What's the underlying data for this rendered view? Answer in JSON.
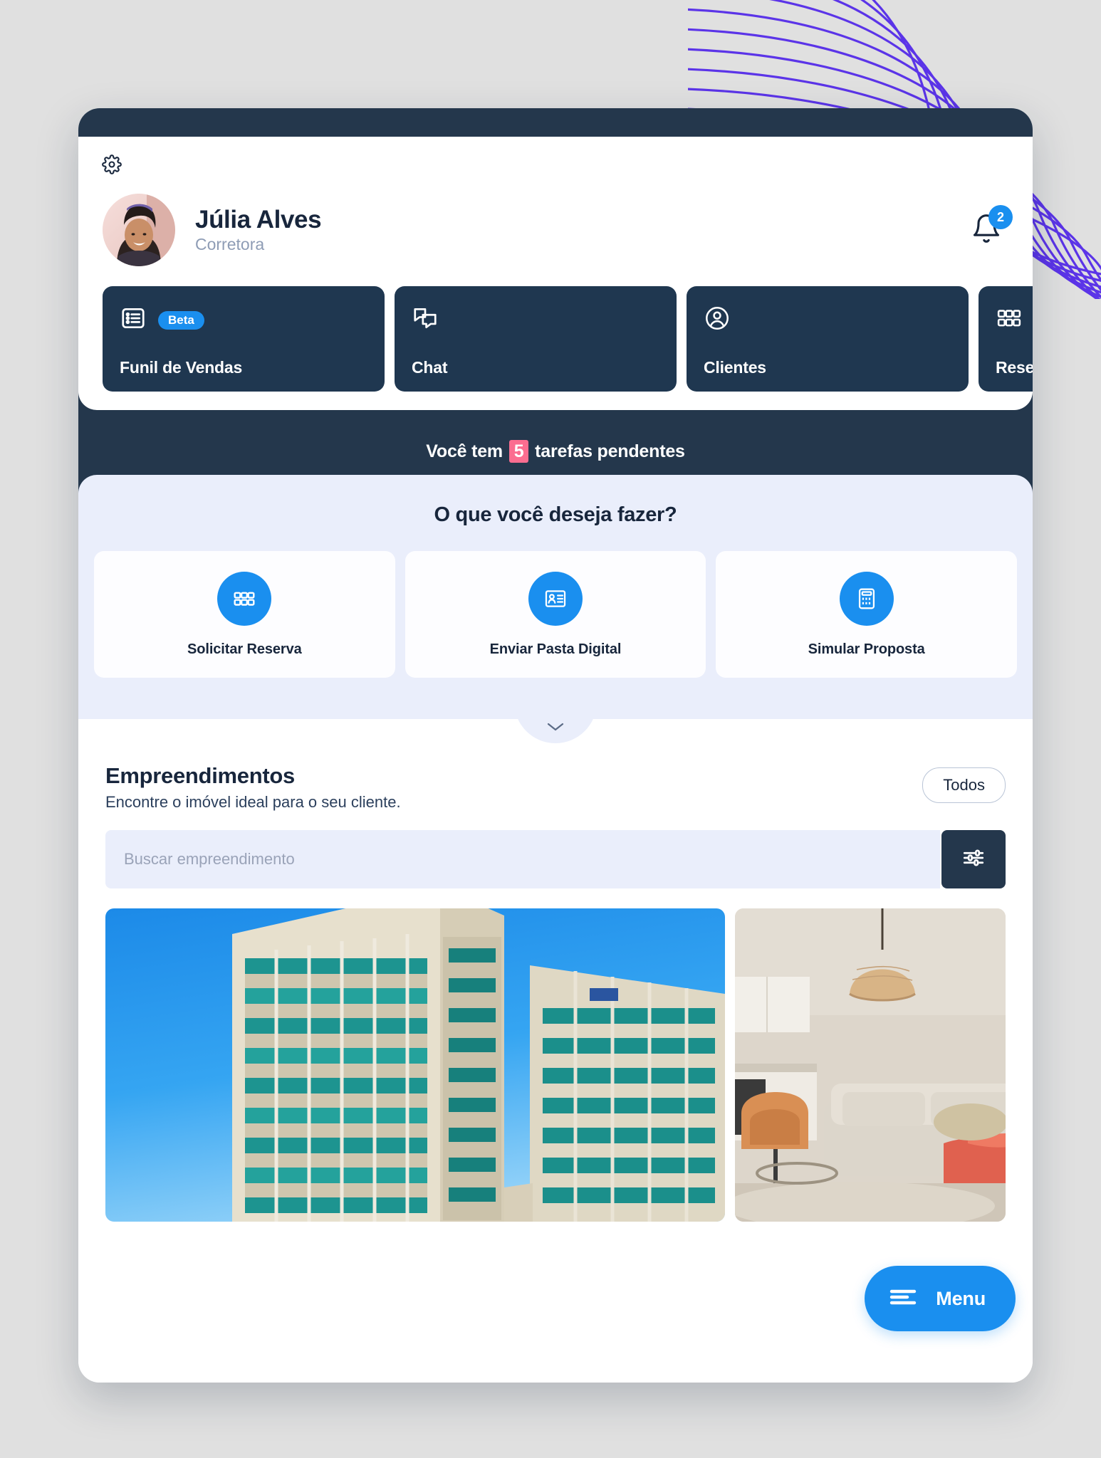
{
  "window": {
    "topbar_color": "#24374c",
    "accent_blue": "#1a8fef",
    "pink": "#fb6d90",
    "panel_bg": "#eaeefb"
  },
  "header": {
    "settings_icon": "gear-icon",
    "profile": {
      "name": "Júlia Alves",
      "role": "Corretora",
      "avatar_alt": "Júlia Alves"
    },
    "notifications": {
      "icon": "bell-icon",
      "count": "2"
    }
  },
  "nav_tiles": [
    {
      "label": "Funil de Vendas",
      "icon": "list-icon",
      "badge": "Beta"
    },
    {
      "label": "Chat",
      "icon": "chat-bubbles-icon",
      "badge": ""
    },
    {
      "label": "Clientes",
      "icon": "user-circle-icon",
      "badge": ""
    },
    {
      "label": "Reserva",
      "icon": "grid-icon",
      "badge": ""
    }
  ],
  "tasks_banner": {
    "prefix": "Você  tem",
    "count": "5",
    "suffix": "tarefas pendentes"
  },
  "actions": {
    "title": "O que você deseja fazer?",
    "cards": [
      {
        "label": "Solicitar Reserva",
        "icon": "grid-icon"
      },
      {
        "label": "Enviar Pasta Digital",
        "icon": "id-card-icon"
      },
      {
        "label": "Simular Proposta",
        "icon": "calculator-icon"
      }
    ],
    "collapse_icon": "chevron-down-icon"
  },
  "empreendimentos": {
    "title": "Empreendimentos",
    "subtitle": "Encontre o imóvel ideal para o seu cliente.",
    "filter_pill": "Todos",
    "search_placeholder": "Buscar empreendimento",
    "search_value": "",
    "filter_icon": "sliders-icon",
    "properties": [
      {
        "alt": "Fachada de edifício residencial alto",
        "type": "building-exterior"
      },
      {
        "alt": "Sala de estar com luminária pendente",
        "type": "living-room-interior"
      }
    ]
  },
  "menu_fab": {
    "label": "Menu",
    "icon": "hamburger-icon"
  }
}
